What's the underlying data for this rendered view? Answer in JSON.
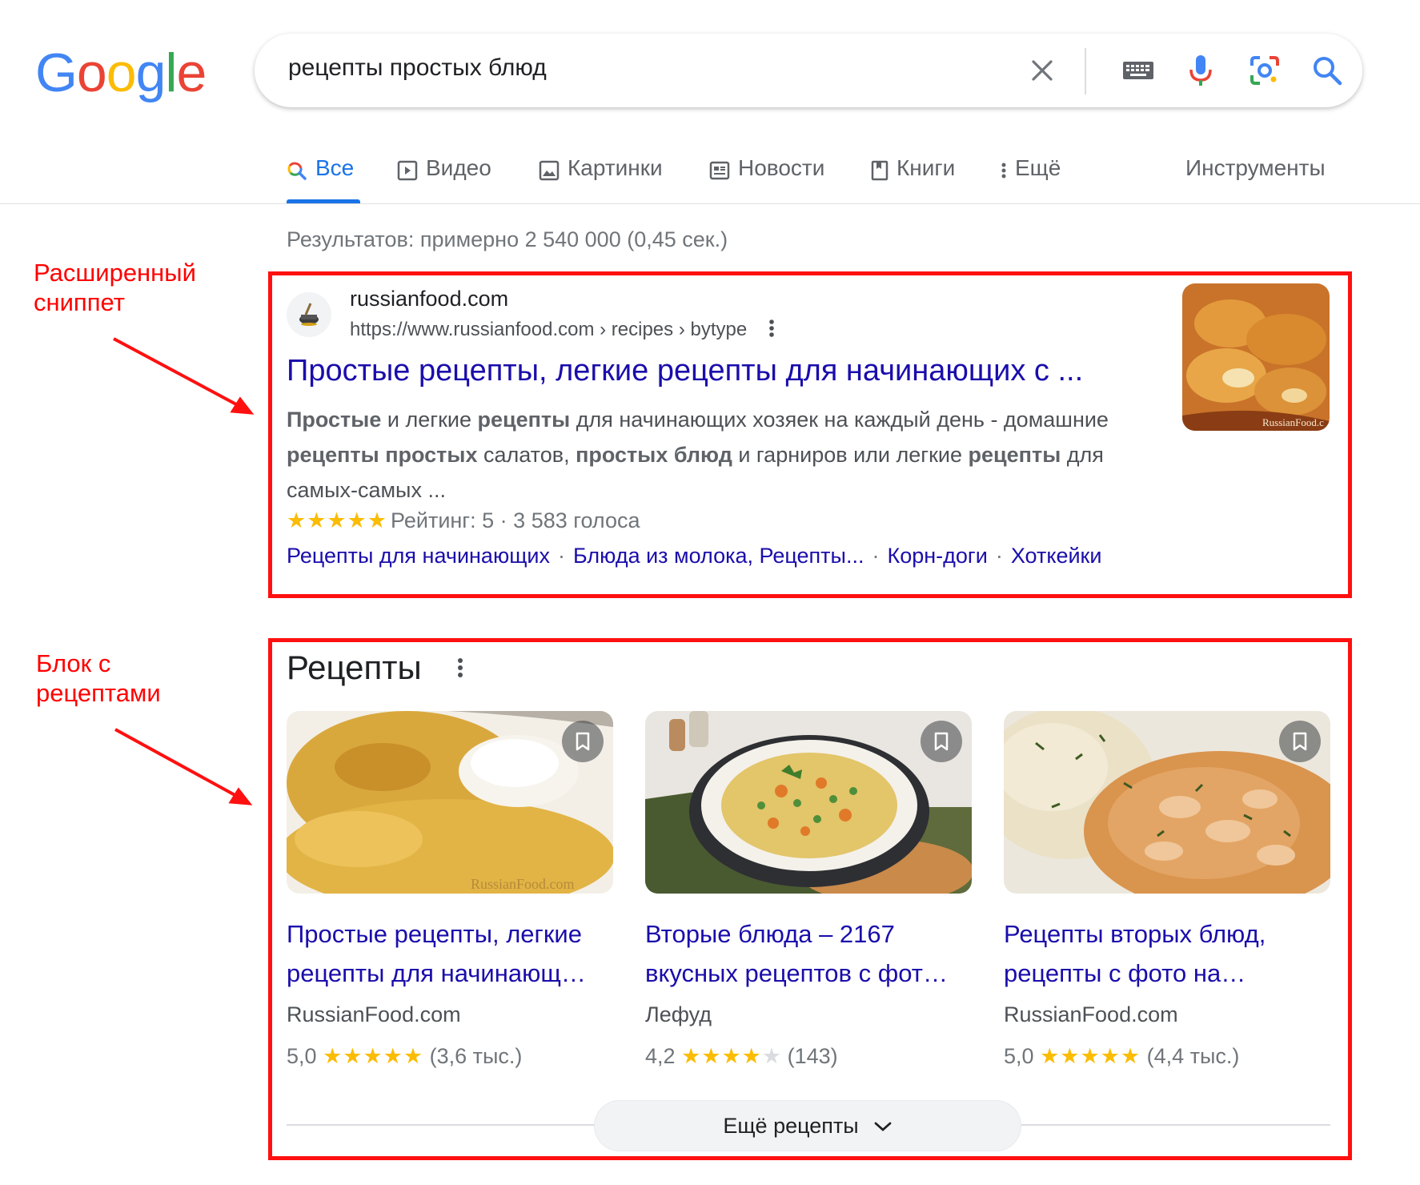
{
  "logo": {
    "letters": [
      "G",
      "o",
      "o",
      "g",
      "l",
      "e"
    ],
    "colors": [
      "#4285F4",
      "#EA4335",
      "#FBBC05",
      "#4285F4",
      "#34A853",
      "#EA4335"
    ]
  },
  "search": {
    "query": "рецепты простых блюд",
    "icons": [
      "clear-icon",
      "keyboard-icon",
      "mic-icon",
      "lens-icon",
      "search-icon"
    ]
  },
  "tabs": [
    {
      "label": "Все",
      "icon": "search-icon",
      "active": true
    },
    {
      "label": "Видео",
      "icon": "play-icon"
    },
    {
      "label": "Картинки",
      "icon": "image-icon"
    },
    {
      "label": "Новости",
      "icon": "news-icon"
    },
    {
      "label": "Книги",
      "icon": "book-icon"
    },
    {
      "label": "Ещё",
      "icon": "more-vert-icon"
    }
  ],
  "tools_label": "Инструменты",
  "results_stats": "Результатов: примерно 2 540 000 (0,45 сек.)",
  "annotations": {
    "snippet_note": [
      "Расширенный",
      "сниппет"
    ],
    "recipes_note": [
      "Блок с",
      "рецептами"
    ]
  },
  "snippet": {
    "site_name": "russianfood.com",
    "url": "https://www.russianfood.com › recipes › bytype",
    "title": "Простые рецепты, легкие рецепты для начинающих с ...",
    "description": [
      {
        "text": "Простые",
        "bold": true
      },
      {
        "text": " и легкие ",
        "bold": false
      },
      {
        "text": "рецепты",
        "bold": true
      },
      {
        "text": " для начинающих хозяек на каждый день - домашние ",
        "bold": false
      },
      {
        "text": "рецепты простых",
        "bold": true
      },
      {
        "text": " салатов, ",
        "bold": false
      },
      {
        "text": "простых блюд",
        "bold": true
      },
      {
        "text": " и гарниров или легкие ",
        "bold": false
      },
      {
        "text": "рецепты",
        "bold": true
      },
      {
        "text": " для самых-самых ...",
        "bold": false
      }
    ],
    "stars": "★★★★★",
    "rating_text": "Рейтинг: 5 · 3 583 голоса",
    "sitelinks": [
      "Рецепты для начинающих",
      "Блюда из молока, Рецепты...",
      "Корн-доги",
      "Хоткейки"
    ],
    "thumb_watermark": "RussianFood.c"
  },
  "recipes": {
    "heading": "Рецепты",
    "cards": [
      {
        "title_line1": "Простые рецепты, легкие",
        "title_line2": "рецепты для начинающ…",
        "source": "RussianFood.com",
        "rating": "5,0",
        "stars_on": "★★★★★",
        "stars_off": "",
        "count": "(3,6 тыс.)",
        "watermark": "RussianFood.com"
      },
      {
        "title_line1": "Вторые блюда – 2167",
        "title_line2": "вкусных рецептов с фот…",
        "source": "Лефуд",
        "rating": "4,2",
        "stars_on": "★★★★",
        "stars_off": "★",
        "count": "(143)",
        "watermark": ""
      },
      {
        "title_line1": "Рецепты вторых блюд,",
        "title_line2": "рецепты с фото на…",
        "source": "RussianFood.com",
        "rating": "5,0",
        "stars_on": "★★★★★",
        "stars_off": "",
        "count": "(4,4 тыс.)",
        "watermark": ""
      }
    ],
    "more_label": "Ещё рецепты"
  },
  "colors": {
    "link": "#1a0dab",
    "accent": "#1a73e8",
    "annotation": "#ff0000",
    "star": "#fbbc04"
  }
}
